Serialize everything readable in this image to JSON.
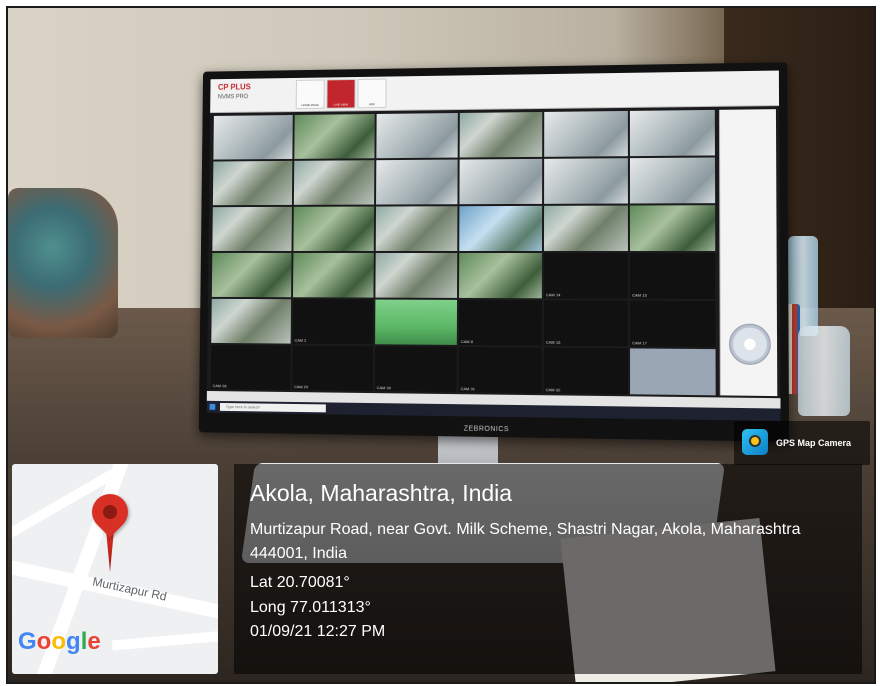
{
  "screen": {
    "brand": "CP PLUS",
    "app_name": "NVMS PRO",
    "toolbar": [
      {
        "label": "HOME PAGE",
        "active": false
      },
      {
        "label": "LIVE VIEW",
        "active": true
      },
      {
        "label": "ADD",
        "active": false
      }
    ],
    "cameras": [
      {
        "name": "",
        "style": "live w"
      },
      {
        "name": "",
        "style": "live g"
      },
      {
        "name": "",
        "style": "live w"
      },
      {
        "name": "",
        "style": "live"
      },
      {
        "name": "",
        "style": "live w"
      },
      {
        "name": "",
        "style": "live w"
      },
      {
        "name": "",
        "style": "live"
      },
      {
        "name": "",
        "style": "live"
      },
      {
        "name": "",
        "style": "live w"
      },
      {
        "name": "",
        "style": "live w"
      },
      {
        "name": "",
        "style": "live w"
      },
      {
        "name": "",
        "style": "live w"
      },
      {
        "name": "",
        "style": "live"
      },
      {
        "name": "",
        "style": "live g"
      },
      {
        "name": "",
        "style": "live"
      },
      {
        "name": "",
        "style": "live b"
      },
      {
        "name": "",
        "style": "live"
      },
      {
        "name": "",
        "style": "live g"
      },
      {
        "name": "",
        "style": "live g"
      },
      {
        "name": "",
        "style": "live g"
      },
      {
        "name": "",
        "style": "live"
      },
      {
        "name": "",
        "style": "live g"
      },
      {
        "name": "CAM 14",
        "style": "dark"
      },
      {
        "name": "CAM 15",
        "style": "dark"
      },
      {
        "name": "",
        "style": "live"
      },
      {
        "name": "CAM 2",
        "style": "dark"
      },
      {
        "name": "",
        "style": "bright"
      },
      {
        "name": "CAM 8",
        "style": "dark"
      },
      {
        "name": "CAM 16",
        "style": "dark"
      },
      {
        "name": "CAM 17",
        "style": "dark"
      },
      {
        "name": "CAM 28",
        "style": "dark"
      },
      {
        "name": "CAM 29",
        "style": "dark"
      },
      {
        "name": "CAM 30",
        "style": "dark"
      },
      {
        "name": "CAM 31",
        "style": "dark"
      },
      {
        "name": "CAM 32",
        "style": "dark"
      },
      {
        "name": "",
        "style": "gray"
      }
    ],
    "taskbar_search": "Type here to search",
    "bezel_brand": "ZEBRONICS"
  },
  "badge": {
    "label": "GPS Map Camera",
    "icon": "gps-camera-icon"
  },
  "map": {
    "road_label": "Murtizapur Rd",
    "logo": "Google"
  },
  "location": {
    "title": "Akola, Maharashtra, India",
    "address": "Murtizapur Road, near Govt. Milk Scheme, Shastri Nagar, Akola, Maharashtra 444001, India",
    "lat": "Lat 20.70081°",
    "long": "Long 77.011313°",
    "datetime": "01/09/21 12:27 PM"
  },
  "colors": {
    "pin": "#d93025",
    "overlay": "#000000",
    "brand_red": "#c0262c"
  }
}
